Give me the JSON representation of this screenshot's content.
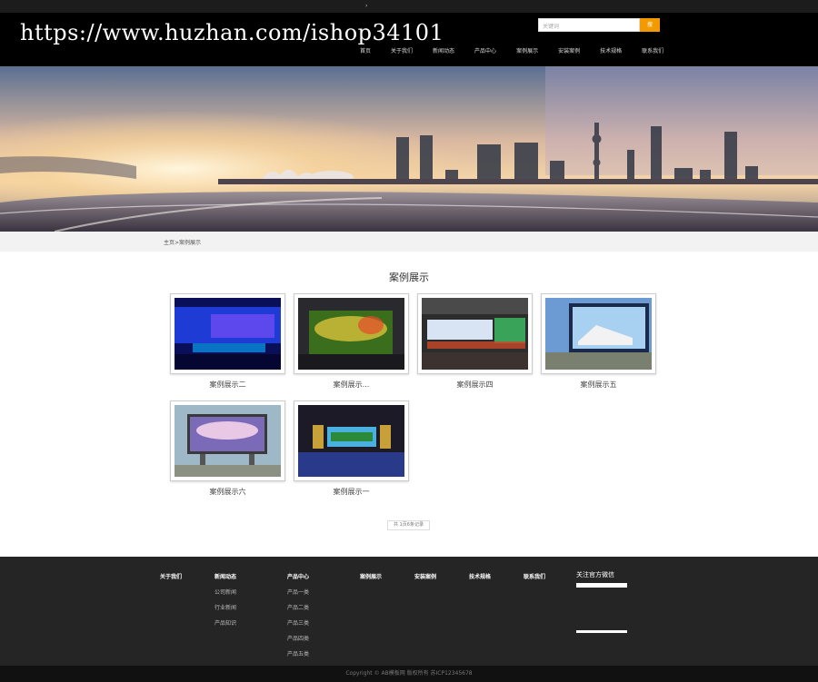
{
  "header": {
    "watermark": "https://www.huzhan.com/ishop34101",
    "search_placeholder": "关键词",
    "search_button": "搜",
    "nav": [
      "首页",
      "关于我们",
      "新闻动态",
      "产品中心",
      "案例展示",
      "安装案例",
      "技术规格",
      "联系我们"
    ]
  },
  "breadcrumb": "主页>案例展示",
  "section": {
    "title": "案例展示",
    "cases": [
      "案例展示二",
      "案例展示...",
      "案例展示四",
      "案例展示五",
      "案例展示六",
      "案例展示一"
    ]
  },
  "pager": "共 1页6条记录",
  "footer": {
    "columns": [
      {
        "title": "关于我们",
        "links": []
      },
      {
        "title": "新闻动态",
        "links": [
          "公司新闻",
          "行业新闻",
          "产品知识"
        ]
      },
      {
        "title": "产品中心",
        "links": [
          "产品一类",
          "产品二类",
          "产品三类",
          "产品四类",
          "产品五类"
        ]
      },
      {
        "title": "案例展示",
        "links": []
      },
      {
        "title": "安装案例",
        "links": []
      },
      {
        "title": "技术规格",
        "links": []
      },
      {
        "title": "联系我们",
        "links": []
      }
    ],
    "follow": "关注官方微信"
  },
  "copyright": "Copyright © AB模板网 版权所有   苏ICP12345678",
  "colors": {
    "header_bg": "#000000",
    "search_button": "#f39a00",
    "footer_bg": "#252525"
  }
}
